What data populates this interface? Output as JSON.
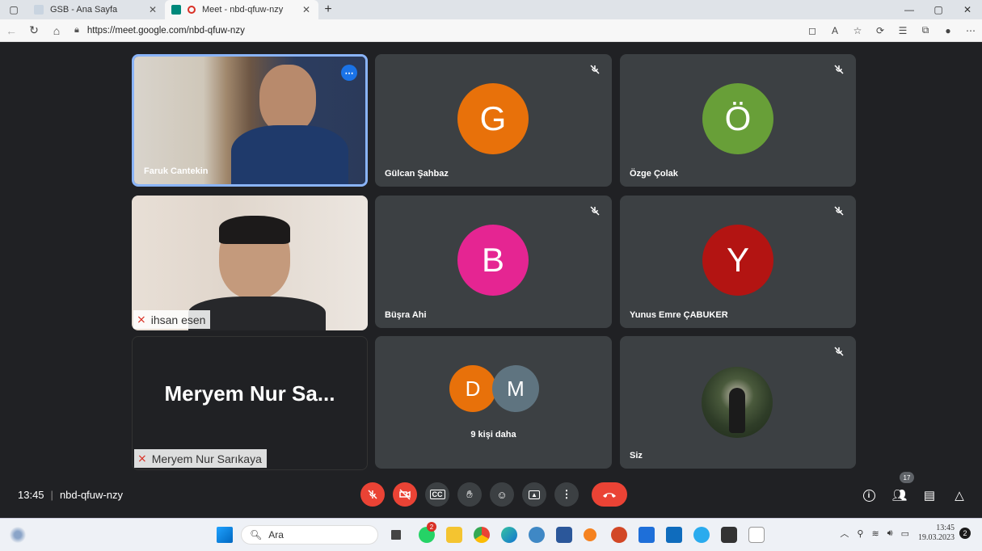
{
  "browser": {
    "tabs": [
      {
        "title": "GSB - Ana Sayfa",
        "active": false
      },
      {
        "title": "Meet - nbd-qfuw-nzy",
        "active": true
      }
    ],
    "url": "https://meet.google.com/nbd-qfuw-nzy"
  },
  "tiles": [
    {
      "name": "Faruk Cantekin",
      "type": "video"
    },
    {
      "name": "Gülcan Şahbaz",
      "initial": "G",
      "color": "#e8710a",
      "muted": true
    },
    {
      "name": "Özge Çolak",
      "initial": "Ö",
      "color": "#689f38",
      "muted": true
    },
    {
      "name": "ihsan esen",
      "type": "video"
    },
    {
      "name": "Büşra Ahi",
      "initial": "B",
      "color": "#e52592",
      "muted": true
    },
    {
      "name": "Yunus Emre ÇABUKER",
      "initial": "Y",
      "color": "#b31412",
      "muted": true
    },
    {
      "name": "Meryem Nur Sarıkaya",
      "bigname": "Meryem Nur Sa...",
      "type": "presenter"
    },
    {
      "name": "9 kişi daha",
      "initials": [
        "D",
        "M"
      ],
      "colors": [
        "#e8710a",
        "#5f7480"
      ]
    },
    {
      "name": "Siz",
      "muted": true
    }
  ],
  "meeting": {
    "time": "13:45",
    "code": "nbd-qfuw-nzy",
    "participants_count": "17"
  },
  "taskbar": {
    "search_label": "Ara",
    "notification_badge": "2",
    "clock_time": "13:45",
    "clock_date": "19.03.2023",
    "tray_notifications": "2"
  }
}
